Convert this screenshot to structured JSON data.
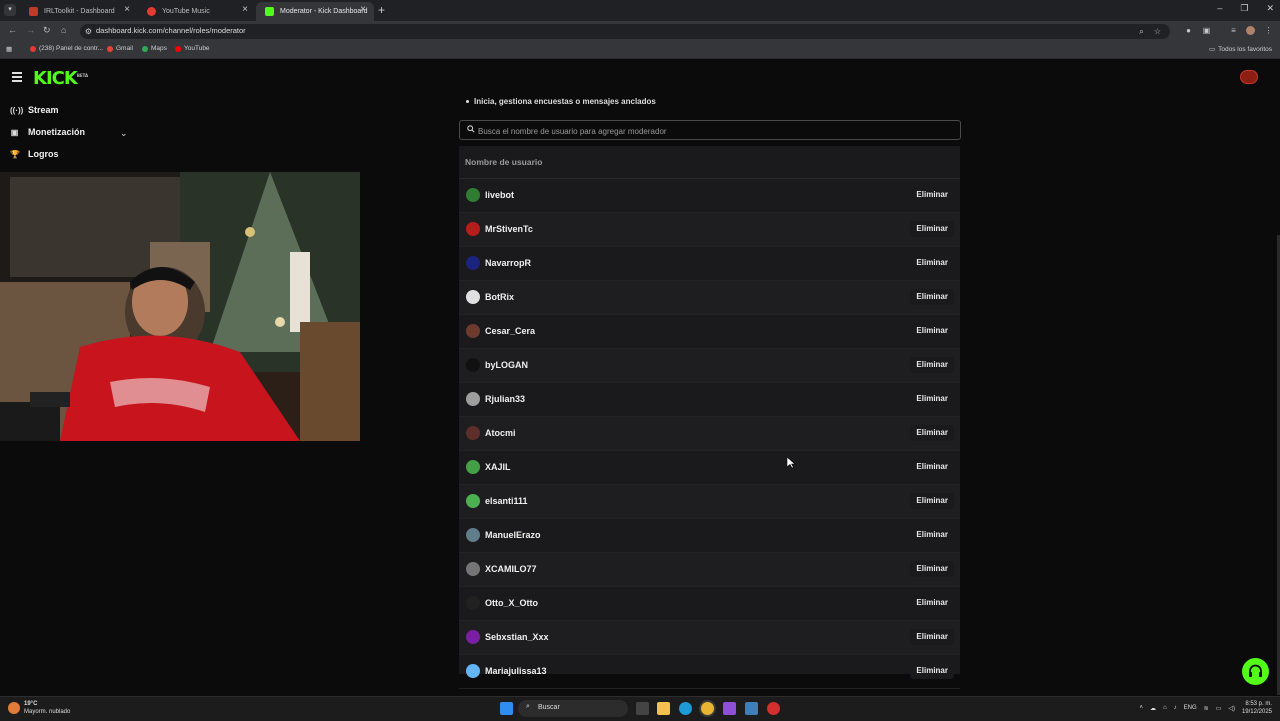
{
  "browser": {
    "tabs": [
      {
        "title": "IRLToolkit - Dashboard",
        "color": "#c0392b"
      },
      {
        "title": "YouTube Music",
        "color": "#e53935"
      },
      {
        "title": "Moderator - Kick Dashboard",
        "color": "#53fc18",
        "active": true
      }
    ],
    "url": "dashboard.kick.com/channel/roles/moderator",
    "bookmarks": [
      {
        "label": "(238) Panel de contr...",
        "color": "#e53935"
      },
      {
        "label": "Gmail",
        "color": "#ea4335"
      },
      {
        "label": "Maps",
        "color": "#34a853"
      },
      {
        "label": "YouTube",
        "color": "#ff0000"
      }
    ],
    "all_bookmarks": "Todos los favoritos"
  },
  "kick": {
    "logo": "KICK",
    "logo_badge": "BETA",
    "sidebar": [
      {
        "label": "Stream",
        "icon": "broadcast-icon"
      },
      {
        "label": "Monetización",
        "icon": "wallet-icon"
      },
      {
        "label": "Logros",
        "icon": "trophy-icon"
      }
    ],
    "permission_text": "Inicia, gestiona encuestas o mensajes anclados",
    "search_placeholder": "Busca el nombre de usuario para agregar moderador",
    "table_header": "Nombre de usuario",
    "remove_label": "Eliminar",
    "moderators": [
      {
        "name": "livebot",
        "avatar": "#2e7d32"
      },
      {
        "name": "MrStivenTc",
        "avatar": "#b71c1c"
      },
      {
        "name": "NavarropR",
        "avatar": "#1a237e"
      },
      {
        "name": "BotRix",
        "avatar": "#e0e0e0"
      },
      {
        "name": "Cesar_Cera",
        "avatar": "#6d3b2e"
      },
      {
        "name": "byLOGAN",
        "avatar": "#111111"
      },
      {
        "name": "Rjulian33",
        "avatar": "#9e9e9e"
      },
      {
        "name": "Atocmi",
        "avatar": "#5d2e2a"
      },
      {
        "name": "XAJIL",
        "avatar": "#43a047"
      },
      {
        "name": "elsanti111",
        "avatar": "#4caf50"
      },
      {
        "name": "ManuelErazo",
        "avatar": "#607d8b"
      },
      {
        "name": "XCAMILO77",
        "avatar": "#757575"
      },
      {
        "name": "Otto_X_Otto",
        "avatar": "#212121"
      },
      {
        "name": "Sebxstian_Xxx",
        "avatar": "#7b1fa2"
      },
      {
        "name": "Mariajulissa13",
        "avatar": "#64b5f6"
      }
    ]
  },
  "taskbar": {
    "weather_temp": "19°C",
    "weather_desc": "Mayorm. nublado",
    "search_label": "Buscar",
    "lang": "ENG",
    "time": "8:53 p. m.",
    "date": "19/12/2025"
  }
}
